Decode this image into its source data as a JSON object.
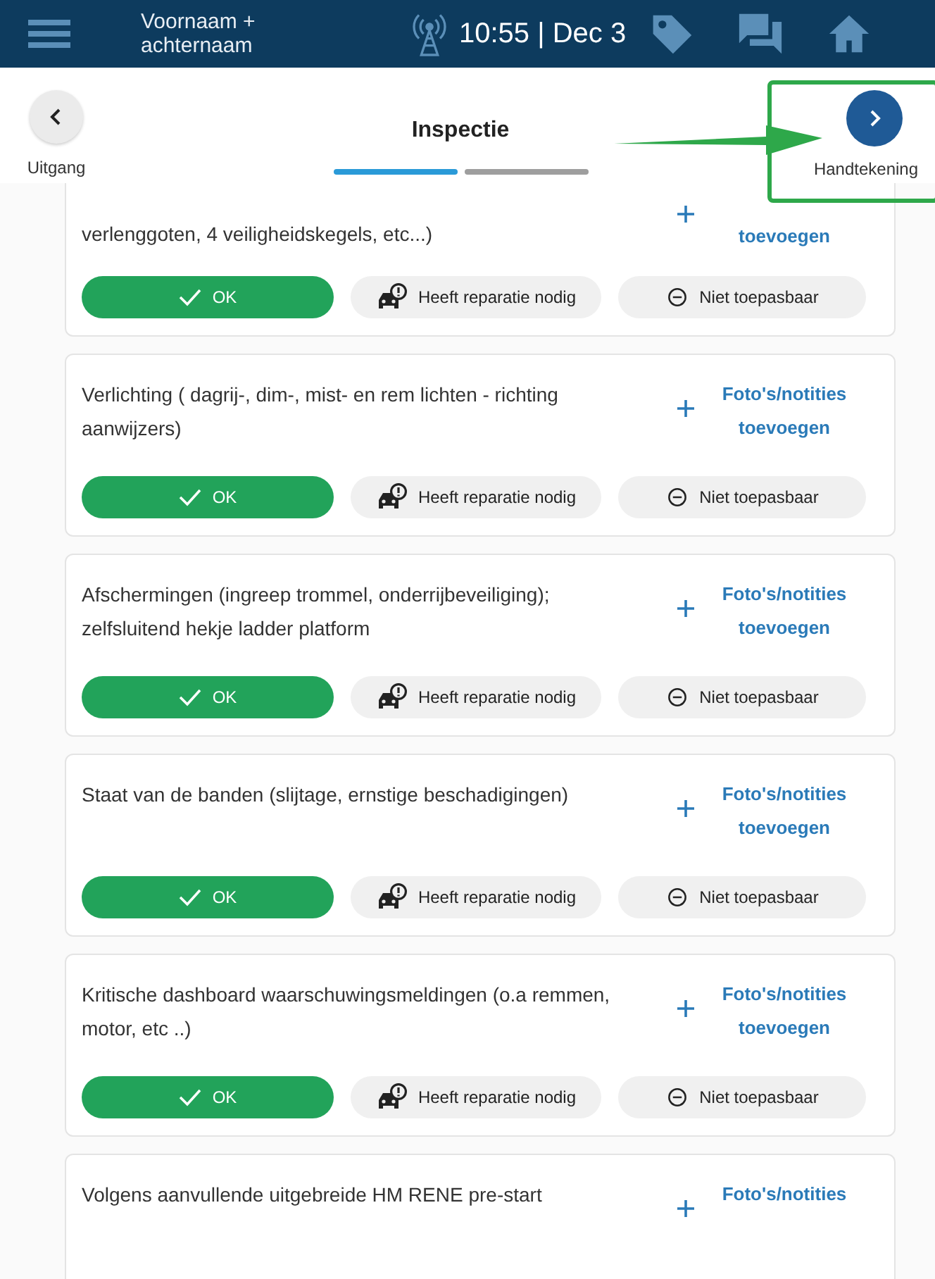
{
  "header": {
    "user_name": "Voornaam + achternaam",
    "datetime": "10:55 | Dec 3"
  },
  "nav": {
    "back_label": "Uitgang",
    "title": "Inspectie",
    "next_label": "Handtekening",
    "next_highlighted": true
  },
  "steps": [
    {
      "selected": true
    },
    {
      "selected": false
    }
  ],
  "items": [
    {
      "partial": true,
      "description": "verlenggoten, 4 veiligheidskegels, etc...)",
      "add_link": "toevoegen",
      "buttons": [
        {
          "kind": "ok",
          "label": "OK",
          "selected": true
        },
        {
          "kind": "repair",
          "label": "Heeft reparatie nodig",
          "selected": false
        },
        {
          "kind": "na",
          "label": "Niet toepasbaar",
          "selected": false
        }
      ]
    },
    {
      "partial": false,
      "description": "Verlichting ( dagrij-, dim-, mist- en rem lichten - richting aanwijzers)",
      "add_link": "Foto's/notities toevoegen",
      "buttons": [
        {
          "kind": "ok",
          "label": "OK",
          "selected": true
        },
        {
          "kind": "repair",
          "label": "Heeft reparatie nodig",
          "selected": false
        },
        {
          "kind": "na",
          "label": "Niet toepasbaar",
          "selected": false
        }
      ]
    },
    {
      "partial": false,
      "description": "Afschermingen (ingreep trommel, onderrijbeveiliging); zelfsluitend hekje ladder platform",
      "add_link": "Foto's/notities toevoegen",
      "buttons": [
        {
          "kind": "ok",
          "label": "OK",
          "selected": true
        },
        {
          "kind": "repair",
          "label": "Heeft reparatie nodig",
          "selected": false
        },
        {
          "kind": "na",
          "label": "Niet toepasbaar",
          "selected": false
        }
      ]
    },
    {
      "partial": false,
      "description": "Staat van de banden (slijtage, ernstige beschadigingen)",
      "add_link": "Foto's/notities toevoegen",
      "buttons": [
        {
          "kind": "ok",
          "label": "OK",
          "selected": true
        },
        {
          "kind": "repair",
          "label": "Heeft reparatie nodig",
          "selected": false
        },
        {
          "kind": "na",
          "label": "Niet toepasbaar",
          "selected": false
        }
      ]
    },
    {
      "partial": false,
      "description": "Kritische dashboard waarschuwingsmeldingen (o.a remmen, motor, etc ..)",
      "add_link": "Foto's/notities toevoegen",
      "buttons": [
        {
          "kind": "ok",
          "label": "OK",
          "selected": true
        },
        {
          "kind": "repair",
          "label": "Heeft reparatie nodig",
          "selected": false
        },
        {
          "kind": "na",
          "label": "Niet toepasbaar",
          "selected": false
        }
      ]
    },
    {
      "partial": false,
      "description": "Volgens aanvullende uitgebreide HM RENE pre-start",
      "add_link": "Foto's/notities"
    }
  ]
}
